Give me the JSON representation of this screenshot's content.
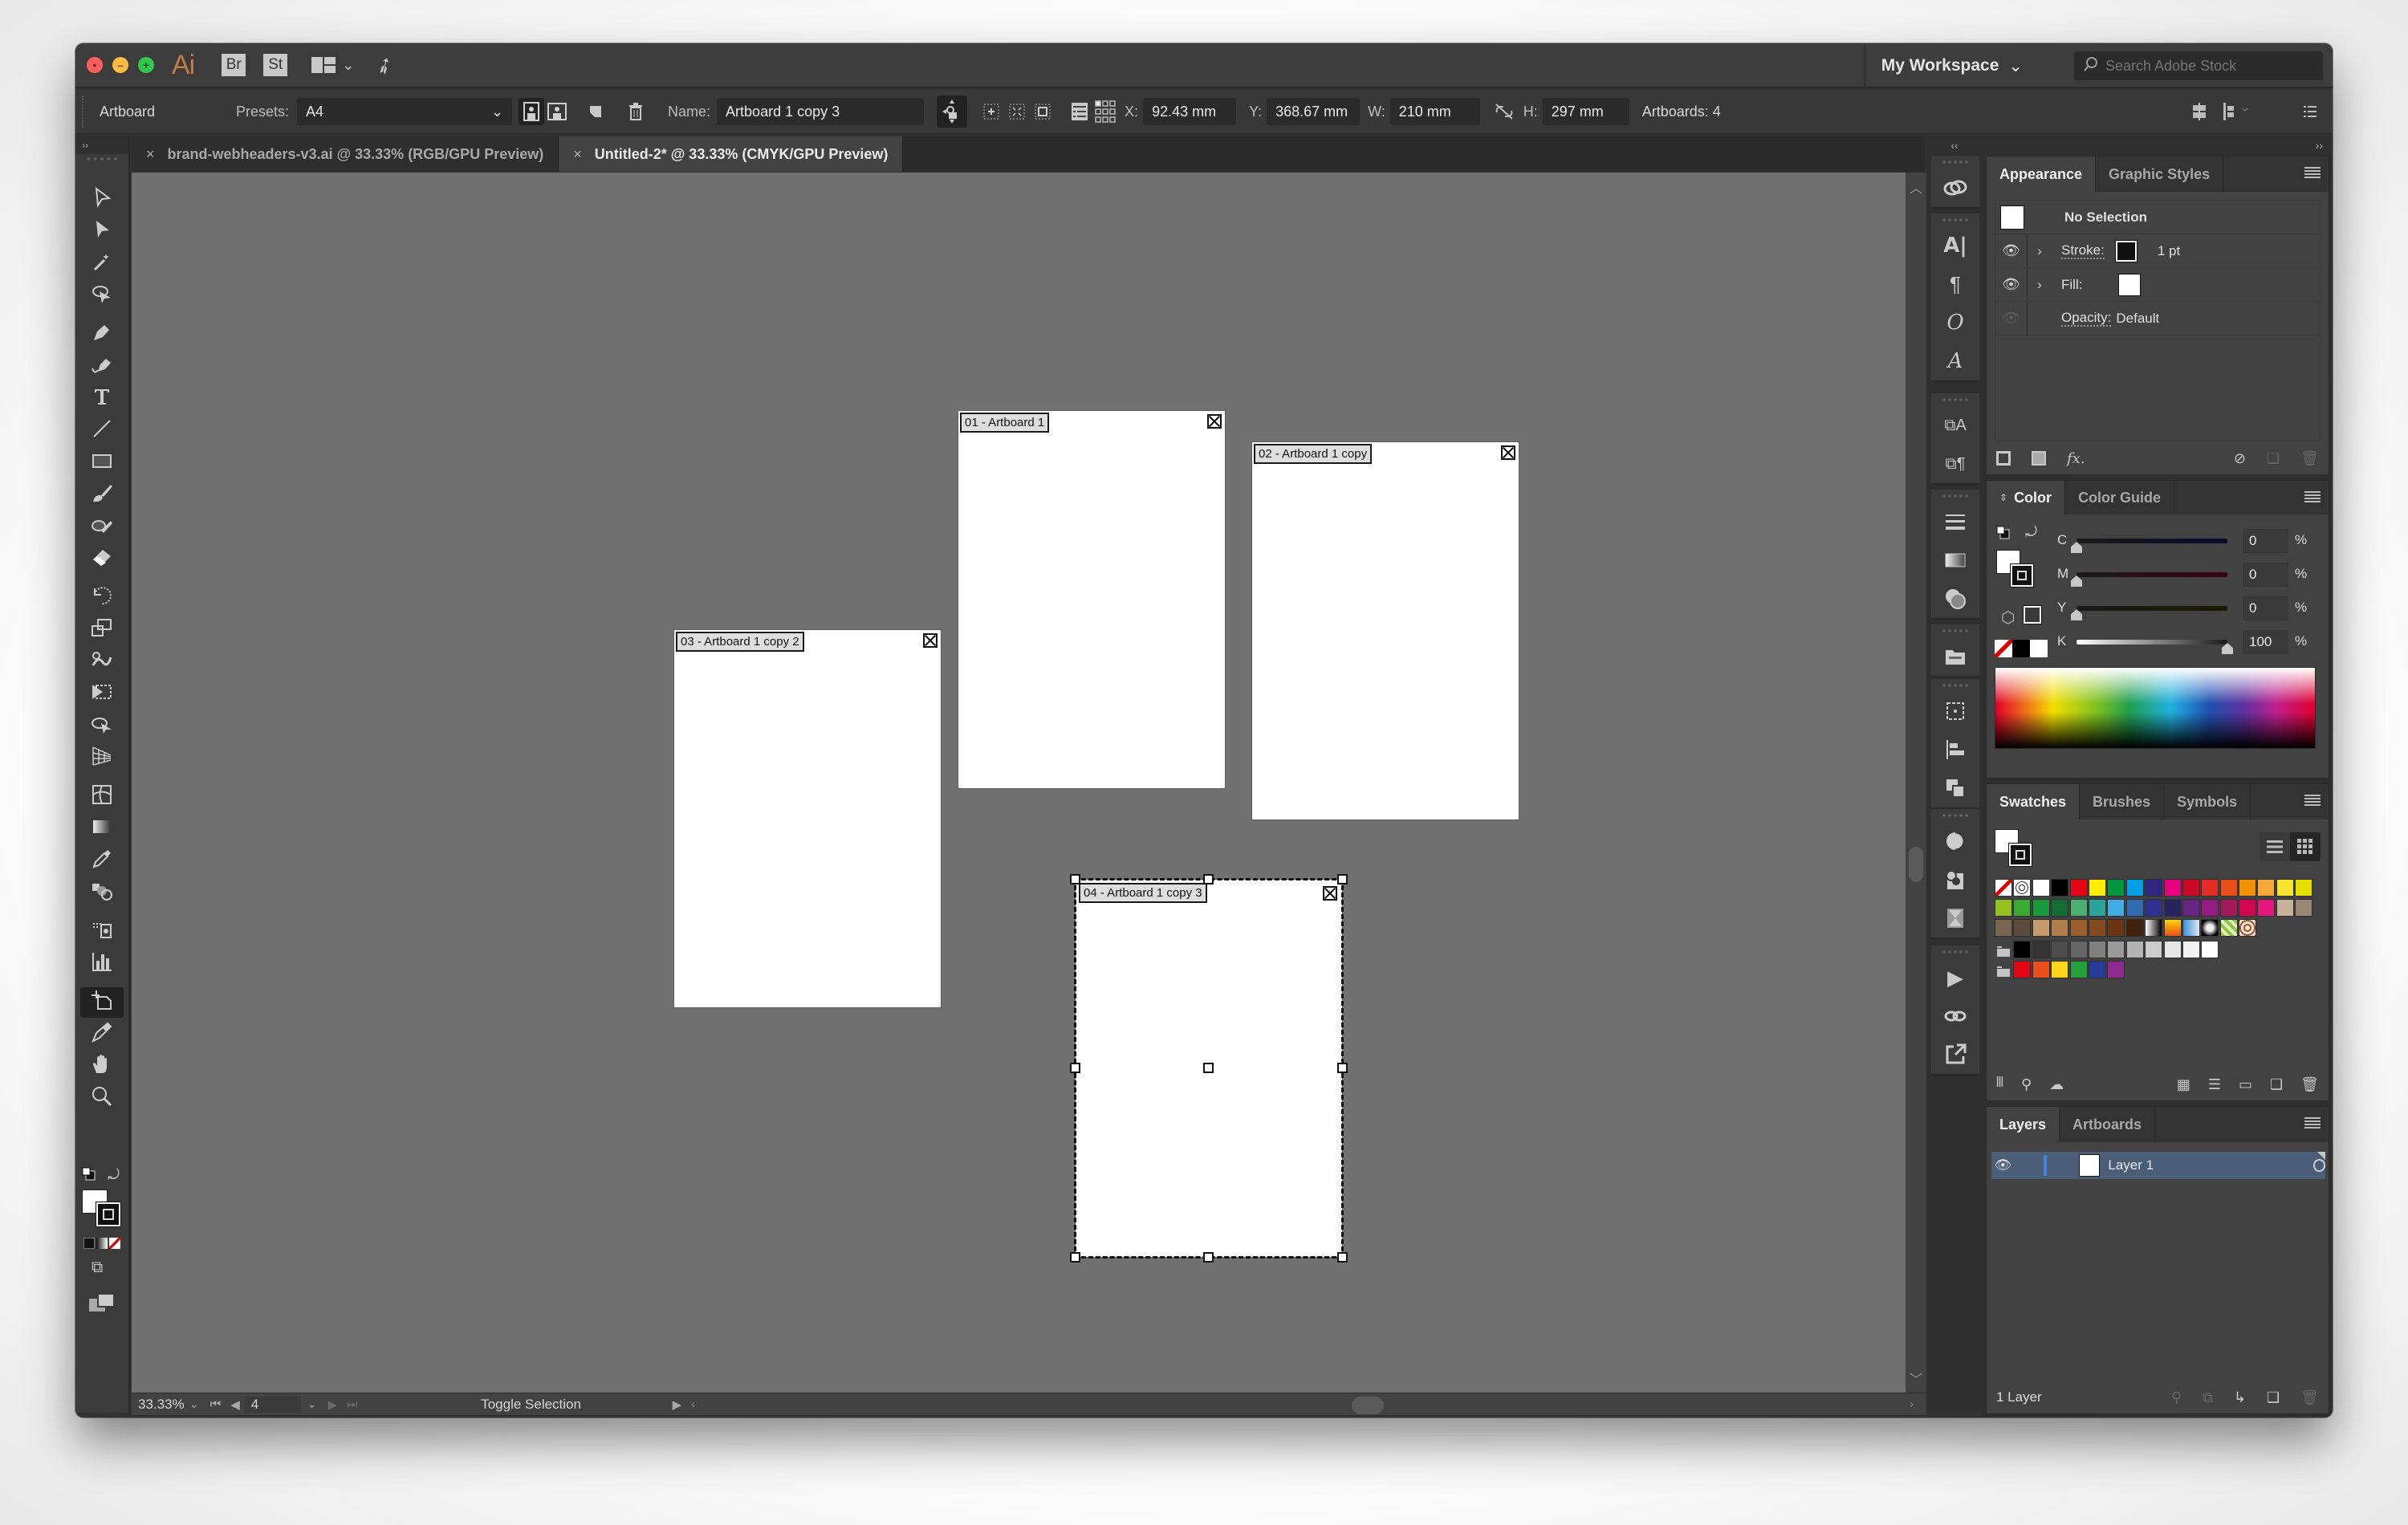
{
  "titlebar": {
    "app_logo": "Ai",
    "bridge_label": "Br",
    "stock_label": "St",
    "workspace_label": "My Workspace",
    "stock_search_placeholder": "Search Adobe Stock"
  },
  "options_bar": {
    "tool_name": "Artboard",
    "presets_label": "Presets:",
    "presets_value": "A4",
    "name_label": "Name:",
    "name_value": "Artboard 1 copy 3",
    "x_label": "X:",
    "x_value": "92.43 mm",
    "y_label": "Y:",
    "y_value": "368.67 mm",
    "w_label": "W:",
    "w_value": "210 mm",
    "h_label": "H:",
    "h_value": "297 mm",
    "artboards_count": "Artboards: 4"
  },
  "tabs": [
    {
      "label": "brand-webheaders-v3.ai @ 33.33% (RGB/GPU Preview)",
      "active": false
    },
    {
      "label": "Untitled-2* @ 33.33% (CMYK/GPU Preview)",
      "active": true
    }
  ],
  "tools": [
    "selection-tool",
    "direct-selection-tool",
    "magic-wand-tool",
    "lasso-tool",
    "pen-tool",
    "curvature-tool",
    "type-tool",
    "line-segment-tool",
    "rectangle-tool",
    "paintbrush-tool",
    "shaper-tool",
    "eraser-tool",
    "rotate-tool",
    "scale-tool",
    "warp-tool",
    "free-transform-tool",
    "shape-builder-tool",
    "perspective-grid-tool",
    "mesh-tool",
    "gradient-tool",
    "eyedropper-tool",
    "blend-tool",
    "symbol-sprayer-tool",
    "column-graph-tool",
    "artboard-tool",
    "slice-tool",
    "hand-tool",
    "zoom-tool"
  ],
  "active_tool": "artboard-tool",
  "canvas": {
    "artboards": [
      {
        "label": "01 - Artboard 1",
        "selected": false
      },
      {
        "label": "02 - Artboard 1 copy",
        "selected": false
      },
      {
        "label": "03 - Artboard 1 copy 2",
        "selected": false
      },
      {
        "label": "04 - Artboard 1 copy 3",
        "selected": true
      }
    ]
  },
  "statusbar": {
    "zoom": "33.33%",
    "page": "4",
    "status": "Toggle Selection"
  },
  "appearance_panel": {
    "tabs": [
      "Appearance",
      "Graphic Styles"
    ],
    "header": "No Selection",
    "stroke_label": "Stroke:",
    "stroke_weight": "1 pt",
    "fill_label": "Fill:",
    "opacity_label": "Opacity:",
    "opacity_value": "Default"
  },
  "color_panel": {
    "tabs": [
      "Color",
      "Color Guide"
    ],
    "channels": [
      {
        "label": "C",
        "value": "0",
        "unit": "%"
      },
      {
        "label": "M",
        "value": "0",
        "unit": "%"
      },
      {
        "label": "Y",
        "value": "0",
        "unit": "%"
      },
      {
        "label": "K",
        "value": "100",
        "unit": "%"
      }
    ]
  },
  "swatches_panel": {
    "tabs": [
      "Swatches",
      "Brushes",
      "Symbols"
    ],
    "rows": [
      [
        "none",
        "registration",
        "#ffffff",
        "#000000",
        "#e30613",
        "#ffed00",
        "#009640",
        "#009fe3",
        "#312783",
        "#e6007e",
        "#cc0a26",
        "#e42d24",
        "#e94e1b",
        "#f39200",
        "#f6a83a",
        "#f7e42f",
        "#e6df00"
      ],
      [
        "#95c11f",
        "#3aaa35",
        "#179a3c",
        "#146c37",
        "#4cb073",
        "#2aa59a",
        "#40aee3",
        "#2e6db4",
        "#2e3192",
        "#27235f",
        "#662483",
        "#951b81",
        "#a3195b",
        "#d3074f",
        "#e5177e",
        "#c7b299",
        "#998675"
      ],
      [
        "#7d6651",
        "#5e4a3a",
        "#c69c6d",
        "#b07d4c",
        "#9b5f2e",
        "#834a1f",
        "#6b3512",
        "#42210b",
        "gradient-bw",
        "gradient-orange",
        "gradient-blue-transparent",
        "gradient-radial",
        "pattern-green",
        "pattern-brown"
      ],
      [
        "folder",
        "#000000",
        "#333333",
        "#4d4d4d",
        "#666666",
        "#808080",
        "#999999",
        "#b3b3b3",
        "#cccccc",
        "#e6e6e6",
        "#f2f2f2",
        "#ffffff"
      ],
      [
        "folder",
        "#e30613",
        "#e94e1b",
        "#fcd617",
        "#25a03a",
        "#243c97",
        "#8f2a90"
      ]
    ]
  },
  "layers_panel": {
    "tabs": [
      "Layers",
      "Artboards"
    ],
    "layers": [
      {
        "name": "Layer 1"
      }
    ],
    "footer": "1 Layer",
    "layer_color": "#4a80e0"
  }
}
